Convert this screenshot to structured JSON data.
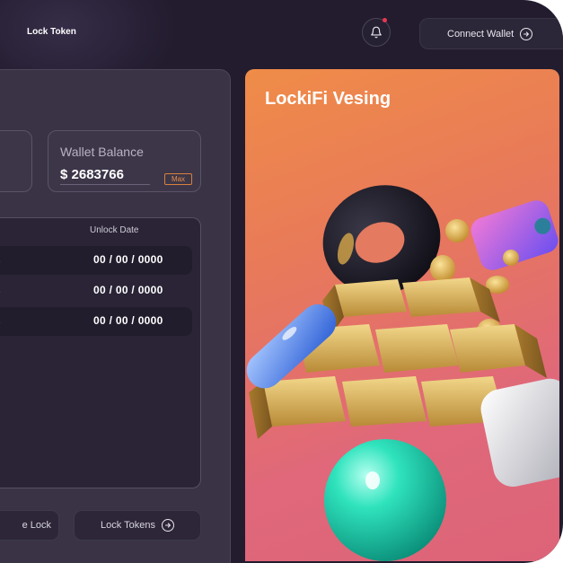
{
  "header": {
    "title": "Lock Token",
    "connect_label": "Connect Wallet"
  },
  "wallet": {
    "label": "Wallet Balance",
    "value": "$ 2683766",
    "max_label": "Max"
  },
  "table": {
    "column_unlock": "Unlock Date",
    "rows": [
      {
        "unlock_date": "00 / 00 / 0000"
      },
      {
        "unlock_date": "00 / 00 / 0000"
      },
      {
        "unlock_date": "00 / 00 / 0000"
      }
    ]
  },
  "actions": {
    "left_label": "e Lock",
    "lock_label": "Lock Tokens"
  },
  "banner": {
    "title": "LockiFi Vesing"
  },
  "colors": {
    "background": "#221c2e",
    "panel": "#3a3346",
    "accent_orange": "#e58e46",
    "notification_dot": "#e8384f"
  },
  "icons": [
    "bell-icon",
    "arrow-right-circle-icon"
  ]
}
